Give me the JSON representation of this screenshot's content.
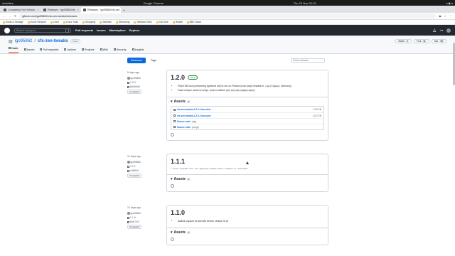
{
  "os_bar": {
    "activities": "Activities",
    "app": "Google Chrome",
    "clock": "Thu 23 Nov 20:15"
  },
  "browser": {
    "tabs": [
      {
        "label": "Completely Fair Schedu",
        "active": false
      },
      {
        "label": "Releases · igo95862/cfs",
        "active": false
      },
      {
        "label": "Releases · igo95862/cfs-zen",
        "active": true
      }
    ],
    "url": "github.com/igo95862/cfs-zen-tweaks/releases",
    "bookmarks": [
      "Email & Storage",
      "Home Network",
      "Linux",
      "Linux Tools",
      "Shopping",
      "Selfwise",
      "Streaming",
      "Selfwise Drills",
      "YouTube",
      "Reddit",
      "BBC News"
    ]
  },
  "github": {
    "search_placeholder": "Search or jump to...",
    "search_key": "/",
    "nav": [
      "Pull requests",
      "Issues",
      "Marketplace",
      "Explore"
    ]
  },
  "repo": {
    "owner": "igo95862",
    "name": "cfs-zen-tweaks",
    "visibility": "Public",
    "buttons": [
      {
        "label": "Watch",
        "count": "2"
      },
      {
        "label": "Fork",
        "count": "11"
      },
      {
        "label": "Star",
        "count": "95"
      }
    ],
    "nav": [
      "Code",
      "Issues",
      "Pull requests",
      "Actions",
      "Projects",
      "Wiki",
      "Security",
      "Insights"
    ],
    "active_nav": "Code"
  },
  "subnav": {
    "releases": "Releases",
    "tags": "Tags",
    "find_placeholder": "Find a release"
  },
  "releases": [
    {
      "age": "5 days ago",
      "author": "igo95862",
      "tag": "1.2.0",
      "commit": "b6b5b48",
      "compare": "Compare",
      "title": "1.2.0",
      "latest": "Latest",
      "notes": [
        {
          "pre": "Fixed SELinux preventing systemd unit to run on Fedora (now script resides in ",
          "code": "/usr/libexec",
          "post": " directory)"
        },
        {
          "pre": "Gave unique name to script. (now is called ",
          "code": "set-cfs-zen-tweaks.bash",
          "post": ")"
        }
      ],
      "assets_label": "Assets",
      "assets_count": "4",
      "assets": [
        {
          "name": "cfs-zen-tweaks-1.2.0-Linux.deb",
          "size": "3.52 KB",
          "paren": ""
        },
        {
          "name": "cfs-zen-tweaks-1.2.0-Linux.rpm",
          "size": "8.57 KB",
          "paren": ""
        },
        {
          "name": "Source code",
          "paren": "(zip)",
          "size": ""
        },
        {
          "name": "Source code",
          "paren": "(tar.gz)",
          "size": ""
        }
      ]
    },
    {
      "age": "10 days ago",
      "author": "igo95862",
      "tag": "1.1.1",
      "commit": "c3f5b1b",
      "compare": "Compare",
      "title": "1.1.1",
      "mono_note": "* Fixed systemd unit not applying tweaks after suspend or hibernate",
      "assets_label": "Assets",
      "assets_count": "4"
    },
    {
      "age": "12 days ago",
      "author": "igo95862",
      "tag": "1.1.0",
      "commit": "6bf17e0",
      "compare": "Compare",
      "title": "1.1.0",
      "notes": [
        {
          "pre": "Added support for kernels before version 5.13",
          "code": "",
          "post": ""
        }
      ],
      "assets_label": "Assets",
      "assets_count": "4"
    }
  ]
}
